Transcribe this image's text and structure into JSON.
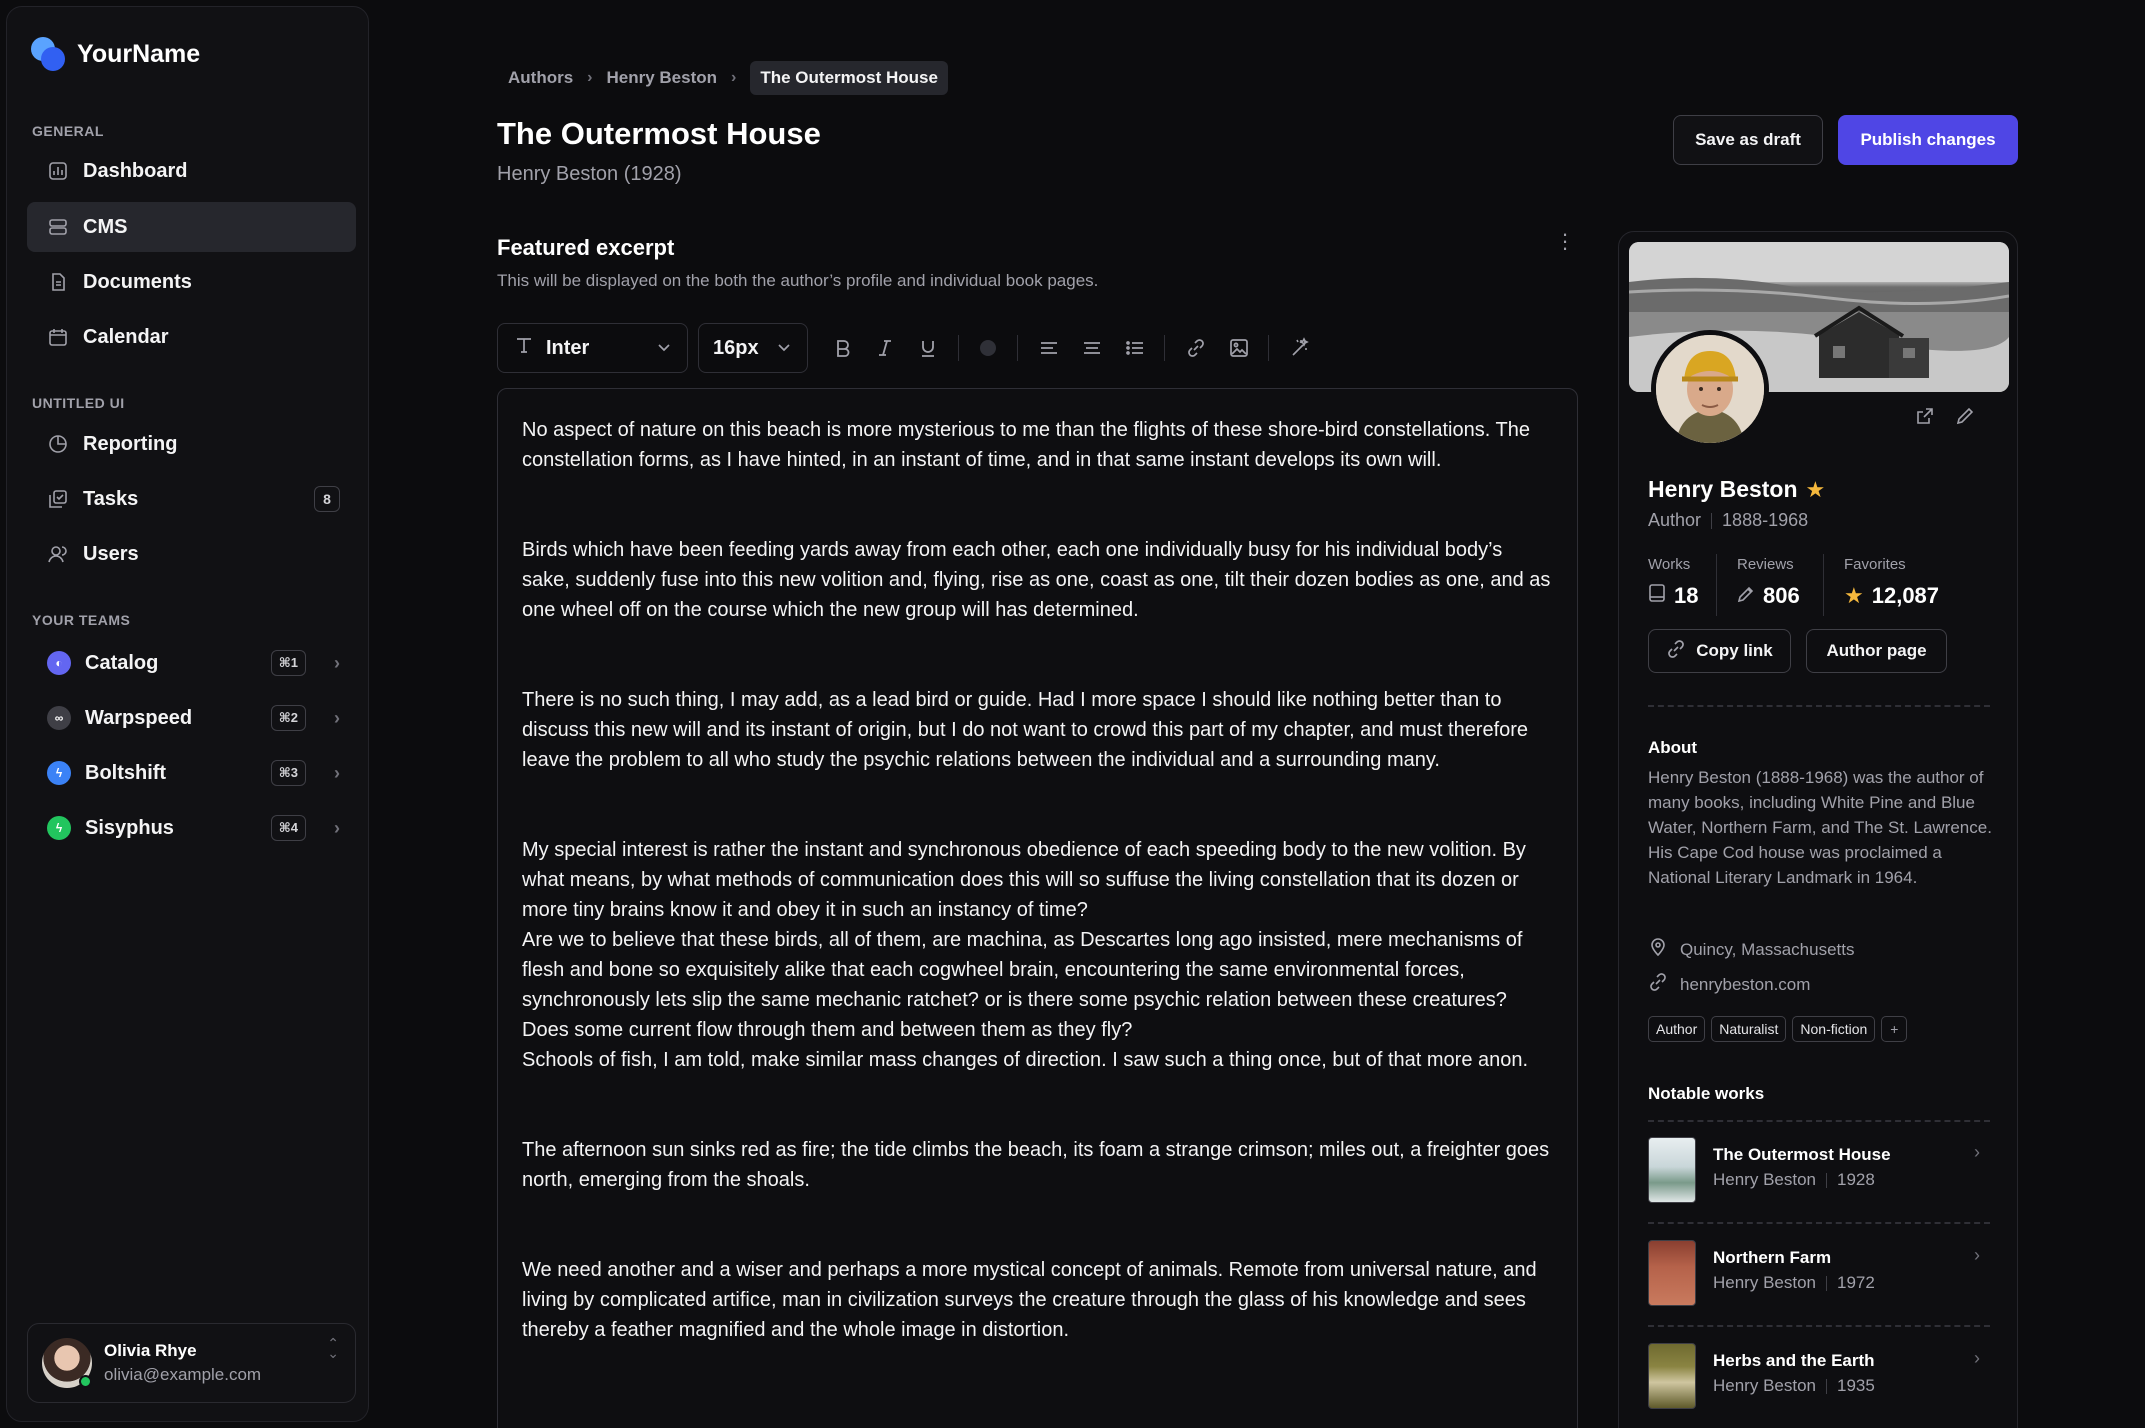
{
  "brand": {
    "name": "YourName"
  },
  "sidebar": {
    "sections": [
      {
        "label": "GENERAL"
      },
      {
        "label": "UNTITLED UI"
      },
      {
        "label": "YOUR TEAMS"
      }
    ],
    "items": [
      {
        "label": "Dashboard",
        "icon": "chart-icon",
        "active": false
      },
      {
        "label": "CMS",
        "icon": "layers-icon",
        "active": true
      },
      {
        "label": "Documents",
        "icon": "document-icon",
        "active": false
      },
      {
        "label": "Calendar",
        "icon": "calendar-icon",
        "active": false
      },
      {
        "label": "Reporting",
        "icon": "pie-chart-icon",
        "active": false
      },
      {
        "label": "Tasks",
        "icon": "tasks-icon",
        "active": false,
        "badge": "8"
      },
      {
        "label": "Users",
        "icon": "users-icon",
        "active": false
      }
    ],
    "teams": [
      {
        "label": "Catalog",
        "shortcut": "⌘1",
        "color": "#6366f1"
      },
      {
        "label": "Warpspeed",
        "shortcut": "⌘2",
        "color": "#3f3f46"
      },
      {
        "label": "Boltshift",
        "shortcut": "⌘3",
        "color": "#3b82f6"
      },
      {
        "label": "Sisyphus",
        "shortcut": "⌘4",
        "color": "#22c55e"
      }
    ],
    "user": {
      "name": "Olivia Rhye",
      "email": "olivia@example.com",
      "status_color": "#22c55e"
    }
  },
  "breadcrumb": [
    "Authors",
    "Henry Beston",
    "The Outermost House"
  ],
  "page": {
    "title": "The Outermost House",
    "subtitle": "Henry Beston (1928)"
  },
  "actions": {
    "draft": "Save as draft",
    "publish": "Publish changes",
    "accent": "#4f46e5"
  },
  "excerpt": {
    "title": "Featured excerpt",
    "description": "This will be displayed on the both the author’s profile and individual book pages.",
    "font": "Inter",
    "size": "16px",
    "paragraphs": [
      "No aspect of nature on this beach is more mysterious to me than the flights of these shore-bird constellations. The constellation forms, as I have hinted, in an instant of time, and in that same instant develops its own will.",
      "Birds which have been feeding yards away from each other, each one individually busy for his individual body’s sake, suddenly fuse into this new volition and, flying, rise as one, coast as one, tilt their dozen bodies as one, and as one wheel off on the course which the new group will has determined.",
      "There is no such thing, I may add, as a lead bird or guide. Had I more space I should like nothing better than to discuss this new will and its instant of origin, but I do not want to crowd this part of my chapter, and must therefore leave the problem to all who study the psychic relations between the individual and a surrounding many.",
      "My special interest is rather the instant and synchronous obedience of each speeding body to the new volition. By what means, by what methods of communication does this will so suffuse the living constellation that its dozen or more tiny brains know it and obey it in such an instancy of time?",
      "Are we to believe that these birds, all of them, are machina, as Descartes long ago insisted, mere mechanisms of flesh and bone so exquisitely alike that each cogwheel brain, encountering the same environmental forces, synchronously lets slip the same mechanic ratchet? or is there some psychic relation between these creatures? Does some current flow through them and between them as they fly?",
      "Schools of fish, I am told, make similar mass changes of direction. I saw such a thing once, but of that more anon.",
      "The afternoon sun sinks red as fire; the tide climbs the beach, its foam a strange crimson; miles out, a freighter goes north, emerging from the shoals.",
      "We need another and a wiser and perhaps a more mystical concept of animals. Remote from universal nature, and living by complicated artifice, man in civilization surveys the creature through the glass of his knowledge and sees thereby a feather magnified and the whole image in distortion."
    ]
  },
  "author": {
    "name": "Henry Beston",
    "role": "Author",
    "years": "1888-1968",
    "stats": [
      {
        "label": "Works",
        "value": "18",
        "icon": "book-icon"
      },
      {
        "label": "Reviews",
        "value": "806",
        "icon": "pen-icon"
      },
      {
        "label": "Favorites",
        "value": "12,087",
        "icon": "star-icon"
      }
    ],
    "copy_link": "Copy link",
    "author_page": "Author page",
    "about_title": "About",
    "about": "Henry Beston (1888-1968) was the author of many books, including White Pine and Blue Water, Northern Farm, and The St. Lawrence. His Cape Cod house was proclaimed a National Literary Landmark in 1964.",
    "location": "Quincy, Massachusetts",
    "website": "henrybeston.com",
    "tags": [
      "Author",
      "Naturalist",
      "Non-fiction"
    ],
    "works_title": "Notable works",
    "works": [
      {
        "title": "The Outermost House",
        "author": "Henry Beston",
        "year": "1928",
        "cover_color": "#c9d6d9"
      },
      {
        "title": "Northern Farm",
        "author": "Henry Beston",
        "year": "1972",
        "cover_color": "#b5624a"
      },
      {
        "title": "Herbs and the Earth",
        "author": "Henry Beston",
        "year": "1935",
        "cover_color": "#8a8442"
      }
    ],
    "star_color": "#f5b83d"
  }
}
